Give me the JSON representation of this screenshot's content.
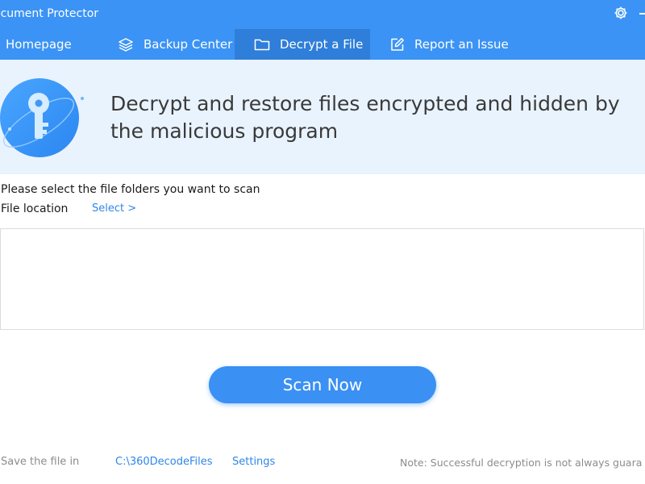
{
  "app": {
    "title": "ocument Protector"
  },
  "tabs": [
    {
      "label": "Homepage",
      "icon": "home-icon",
      "active": false
    },
    {
      "label": "Backup Center",
      "icon": "layers-icon",
      "active": false
    },
    {
      "label": "Decrypt a File",
      "icon": "folder-icon",
      "active": true
    },
    {
      "label": "Report an Issue",
      "icon": "edit-icon",
      "active": false
    }
  ],
  "banner": {
    "title": "Decrypt and restore files encrypted and hidden by the malicious program",
    "icon": "key-icon"
  },
  "content": {
    "instruction": "Please select the file folders you want to scan",
    "file_location_label": "File location",
    "select_link": "Select >",
    "scan_button": "Scan Now"
  },
  "footer": {
    "save_label": "Save the file in",
    "save_path": "C:\\360DecodeFiles",
    "settings_link": "Settings",
    "note": "Note: Successful decryption is not always guara"
  },
  "colors": {
    "primary": "#3b93f5",
    "active_tab": "#2f7ed9",
    "banner_bg": "#e9f3fd",
    "link": "#2f86e8"
  }
}
